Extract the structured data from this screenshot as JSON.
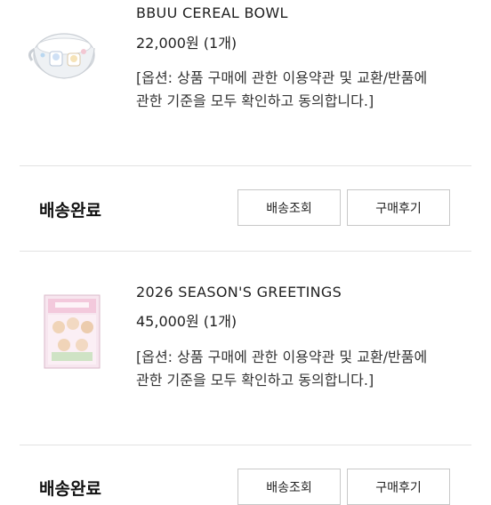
{
  "orders": [
    {
      "product_name": "BBUU CEREAL BOWL",
      "price": "22,000원 (1개)",
      "option": "[옵션: 상품 구매에 관한 이용약관 및 교환/반품에 관한 기준을 모두 확인하고 동의합니다.]",
      "status": "배송완료",
      "track_label": "배송조회",
      "review_label": "구매후기"
    },
    {
      "product_name": "2026 SEASON'S GREETINGS",
      "price": "45,000원 (1개)",
      "option": "[옵션: 상품 구매에 관한 이용약관 및 교환/반품에 관한 기준을 모두 확인하고 동의합니다.]",
      "status": "배송완료",
      "track_label": "배송조회",
      "review_label": "구매후기"
    }
  ]
}
